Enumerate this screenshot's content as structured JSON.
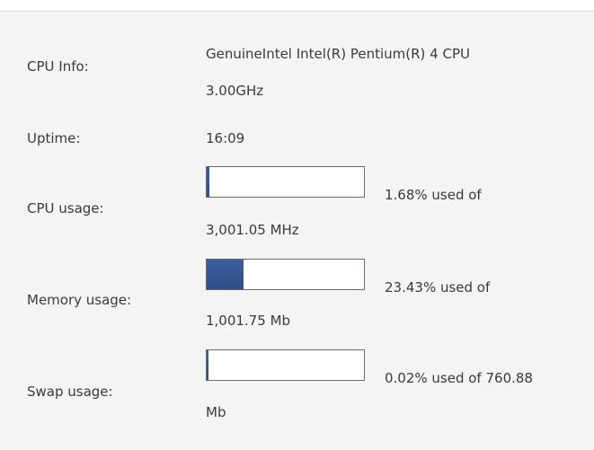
{
  "cpu_info": {
    "label": "CPU Info:",
    "value_line1": "GenuineIntel Intel(R) Pentium(R) 4 CPU",
    "value_line2": "3.00GHz"
  },
  "uptime": {
    "label": "Uptime:",
    "value": "16:09"
  },
  "cpu_usage": {
    "label": "CPU usage:",
    "percent": 1.68,
    "text_line1": "1.68% used of",
    "text_line2": "3,001.05 MHz"
  },
  "memory_usage": {
    "label": "Memory usage:",
    "percent": 23.43,
    "text_line1": "23.43% used of",
    "text_line2": "1,001.75 Mb"
  },
  "swap_usage": {
    "label": "Swap usage:",
    "percent": 0.02,
    "text_line1": "0.02% used of 760.88",
    "text_line2": "Mb"
  },
  "colors": {
    "bar_fill": "#2f4e86",
    "background": "#f4f4f4"
  }
}
